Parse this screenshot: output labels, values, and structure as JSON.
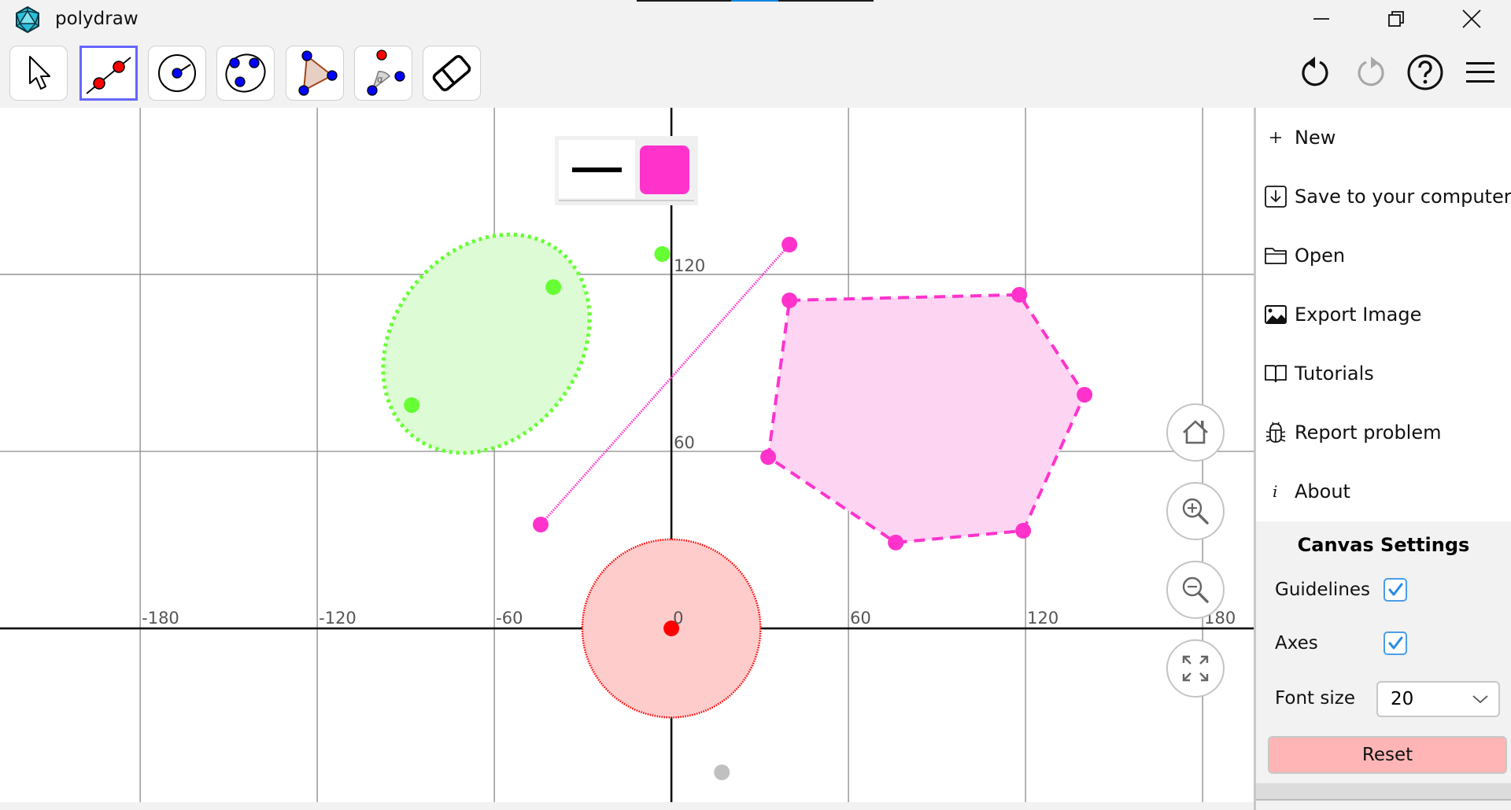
{
  "app": {
    "title": "polydraw",
    "logo_icon": "icosahedron-icon"
  },
  "window_controls": {
    "minimize_icon": "minimize-icon",
    "restore_icon": "restore-icon",
    "close_icon": "close-icon"
  },
  "toolbar": {
    "tools": [
      {
        "id": "move",
        "icon": "pointer-arrow-icon",
        "selected": false
      },
      {
        "id": "line",
        "icon": "line-through-two-points-icon",
        "selected": true
      },
      {
        "id": "circle-center-point",
        "icon": "circle-center-point-icon",
        "selected": false
      },
      {
        "id": "circle-three-points",
        "icon": "circle-three-points-icon",
        "selected": false
      },
      {
        "id": "polygon",
        "icon": "polygon-icon",
        "selected": false
      },
      {
        "id": "angle",
        "icon": "angle-icon",
        "selected": false
      },
      {
        "id": "eraser",
        "icon": "eraser-icon",
        "selected": false
      }
    ],
    "angle_symbol": "α",
    "actions": [
      {
        "id": "undo",
        "icon": "undo-icon",
        "enabled": true
      },
      {
        "id": "redo",
        "icon": "redo-icon",
        "enabled": false
      },
      {
        "id": "help",
        "icon": "help-icon",
        "enabled": true
      },
      {
        "id": "menu",
        "icon": "hamburger-menu-icon",
        "enabled": true
      }
    ]
  },
  "style_bar": {
    "line_style": "solid",
    "color": "#ff33cc"
  },
  "canvas": {
    "x_ticks": [
      -180,
      -120,
      -60,
      0,
      60,
      120,
      180
    ],
    "y_ticks": [
      60,
      120
    ],
    "x_tick_labels": [
      "-180",
      "-120",
      "-60",
      "0",
      "60",
      "120",
      "180"
    ],
    "y_tick_labels": [
      "60",
      "120"
    ],
    "view": {
      "xmin": -227.5,
      "xmax": 197.3,
      "ymin": -58.9,
      "ymax": 176.5
    },
    "grid": true,
    "axes": true,
    "objects": {
      "ellipse": {
        "color": "#66ff33",
        "fill": "#ddfbd5",
        "line_style": "dotted",
        "center": [
          -62.7,
          96.5
        ],
        "semi_major": 40,
        "semi_minor": 31.5,
        "rotation_deg": -52,
        "points": [
          [
            -3.1,
            126.9
          ],
          [
            -40.0,
            115.7
          ],
          [
            -88.0,
            75.7
          ]
        ]
      },
      "segment": {
        "color": "#ff33cc",
        "line_style": "dashed-thin",
        "endpoints": [
          [
            -44.3,
            35.2
          ],
          [
            40.0,
            130.1
          ]
        ]
      },
      "pentagon": {
        "color": "#ff33cc",
        "fill": "#fdd4f2",
        "line_style": "dashed",
        "vertices": [
          [
            40.0,
            111.2
          ],
          [
            117.9,
            113.1
          ],
          [
            140.0,
            79.2
          ],
          [
            119.2,
            33.1
          ],
          [
            76.0,
            29.1
          ],
          [
            32.8,
            58.1
          ]
        ]
      },
      "circle": {
        "color": "#ff0000",
        "fill": "#ffcccc",
        "line_style": "dotted-thin",
        "center": [
          0,
          0
        ],
        "radius": 30.2
      },
      "loose_point": {
        "color": "#c0c0c0",
        "position": [
          17.1,
          -48.8
        ]
      }
    }
  },
  "navigation": {
    "home_icon": "home-icon",
    "zoom_in_icon": "zoom-in-icon",
    "zoom_out_icon": "zoom-out-icon",
    "fullscreen_icon": "fullscreen-icon"
  },
  "menu": {
    "items": [
      {
        "id": "new",
        "icon": "plus-icon",
        "label": "New"
      },
      {
        "id": "save",
        "icon": "save-download-icon",
        "label": "Save to your computer"
      },
      {
        "id": "open",
        "icon": "folder-icon",
        "label": "Open"
      },
      {
        "id": "export",
        "icon": "image-icon",
        "label": "Export Image"
      },
      {
        "id": "tutorials",
        "icon": "book-icon",
        "label": "Tutorials"
      },
      {
        "id": "report",
        "icon": "bug-icon",
        "label": "Report problem"
      },
      {
        "id": "about",
        "icon": "info-icon",
        "label": "About"
      }
    ]
  },
  "canvas_settings": {
    "title": "Canvas Settings",
    "guidelines_label": "Guidelines",
    "guidelines_checked": true,
    "axes_label": "Axes",
    "axes_checked": true,
    "font_size_label": "Font size",
    "font_size_value": "20",
    "reset_label": "Reset"
  }
}
